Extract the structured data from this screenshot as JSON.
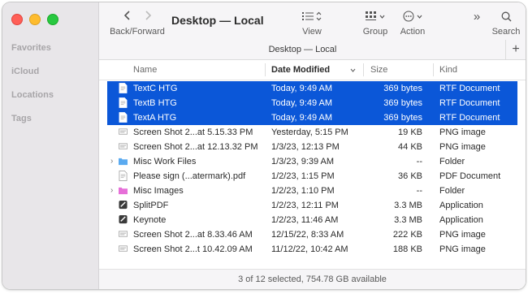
{
  "sidebar": {
    "sections": [
      {
        "label": "Favorites"
      },
      {
        "label": "iCloud"
      },
      {
        "label": "Locations"
      },
      {
        "label": "Tags"
      }
    ]
  },
  "toolbar": {
    "title": "Desktop — Local",
    "back_forward_label": "Back/Forward",
    "view_label": "View",
    "group_label": "Group",
    "action_label": "Action",
    "search_label": "Search",
    "more_label": "»"
  },
  "pathbar": {
    "title": "Desktop — Local",
    "add_label": "+"
  },
  "columns": {
    "name": "Name",
    "date_modified": "Date Modified",
    "size": "Size",
    "kind": "Kind"
  },
  "rows": [
    {
      "name": "TextC HTG",
      "date": "Today, 9:49 AM",
      "size": "369 bytes",
      "kind": "RTF Document",
      "selected": true,
      "icon": "document-icon",
      "disclosure": false
    },
    {
      "name": "TextB HTG",
      "date": "Today, 9:49 AM",
      "size": "369 bytes",
      "kind": "RTF Document",
      "selected": true,
      "icon": "document-icon",
      "disclosure": false
    },
    {
      "name": "TextA HTG",
      "date": "Today, 9:49 AM",
      "size": "369 bytes",
      "kind": "RTF Document",
      "selected": true,
      "icon": "document-icon",
      "disclosure": false
    },
    {
      "name": "Screen Shot 2...at 5.15.33 PM",
      "date": "Yesterday, 5:15 PM",
      "size": "19 KB",
      "kind": "PNG image",
      "selected": false,
      "icon": "image-icon",
      "disclosure": false
    },
    {
      "name": "Screen Shot 2...at 12.13.32 PM",
      "date": "1/3/23, 12:13 PM",
      "size": "44 KB",
      "kind": "PNG image",
      "selected": false,
      "icon": "image-icon",
      "disclosure": false
    },
    {
      "name": "Misc Work Files",
      "date": "1/3/23, 9:39 AM",
      "size": "--",
      "kind": "Folder",
      "selected": false,
      "icon": "folder-icon",
      "disclosure": true
    },
    {
      "name": "Please sign  (...atermark).pdf",
      "date": "1/2/23, 1:15 PM",
      "size": "36 KB",
      "kind": "PDF Document",
      "selected": false,
      "icon": "document-icon",
      "disclosure": false
    },
    {
      "name": "Misc Images",
      "date": "1/2/23, 1:10 PM",
      "size": "--",
      "kind": "Folder",
      "selected": false,
      "icon": "pink-folder-icon",
      "disclosure": true
    },
    {
      "name": "SplitPDF",
      "date": "1/2/23, 12:11 PM",
      "size": "3.3 MB",
      "kind": "Application",
      "selected": false,
      "icon": "app-icon",
      "disclosure": false
    },
    {
      "name": "Keynote",
      "date": "1/2/23, 11:46 AM",
      "size": "3.3 MB",
      "kind": "Application",
      "selected": false,
      "icon": "app-icon",
      "disclosure": false
    },
    {
      "name": "Screen Shot 2...at 8.33.46 AM",
      "date": "12/15/22, 8:33 AM",
      "size": "222 KB",
      "kind": "PNG image",
      "selected": false,
      "icon": "image-icon",
      "disclosure": false
    },
    {
      "name": "Screen Shot 2...t 10.42.09 AM",
      "date": "11/12/22, 10:42 AM",
      "size": "188 KB",
      "kind": "PNG image",
      "selected": false,
      "icon": "image-icon",
      "disclosure": false
    }
  ],
  "status": {
    "text": "3 of 12 selected, 754.78 GB available"
  },
  "colors": {
    "selection": "#0b57d8",
    "folder_blue": "#5aaaf0",
    "folder_pink": "#e66fd8"
  }
}
